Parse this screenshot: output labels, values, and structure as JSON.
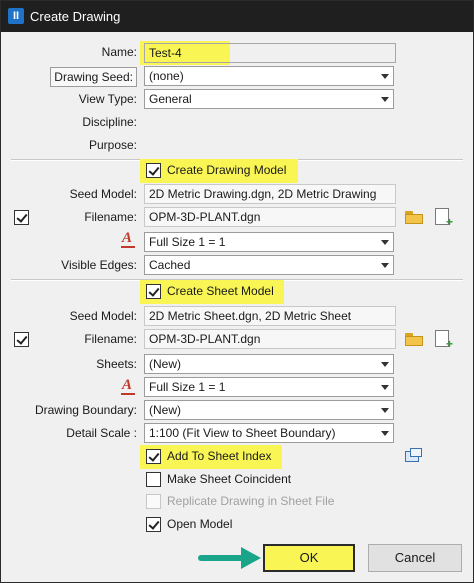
{
  "window": {
    "title": "Create Drawing",
    "app_icon_text": "II"
  },
  "general": {
    "name_label": "Name:",
    "name_value": "Test-4",
    "seed_label": "Drawing Seed:",
    "seed_value": "(none)",
    "view_type_label": "View Type:",
    "view_type_value": "General",
    "discipline_label": "Discipline:",
    "purpose_label": "Purpose:"
  },
  "drawing_model": {
    "create_label": "Create Drawing Model",
    "create_checked": true,
    "seed_model_label": "Seed Model:",
    "seed_model_value": "2D Metric Drawing.dgn, 2D Metric Drawing",
    "filename_label": "Filename:",
    "filename_value": "OPM-3D-PLANT.dgn",
    "filename_checked": true,
    "annotation_scale_value": "Full Size 1 = 1",
    "visible_edges_label": "Visible Edges:",
    "visible_edges_value": "Cached"
  },
  "sheet_model": {
    "create_label": "Create Sheet Model",
    "create_checked": true,
    "seed_model_label": "Seed Model:",
    "seed_model_value": "2D Metric Sheet.dgn, 2D Metric Sheet",
    "filename_label": "Filename:",
    "filename_value": "OPM-3D-PLANT.dgn",
    "filename_checked": true,
    "sheets_label": "Sheets:",
    "sheets_value": "(New)",
    "annotation_scale_value": "Full Size 1 = 1",
    "boundary_label": "Drawing Boundary:",
    "boundary_value": "(New)",
    "detail_scale_label": "Detail Scale :",
    "detail_scale_value": "1:100 (Fit View to Sheet Boundary)",
    "add_index_label": "Add To Sheet Index",
    "add_index_checked": true,
    "coincident_label": "Make Sheet Coincident",
    "coincident_checked": false,
    "replicate_label": "Replicate Drawing in Sheet File",
    "replicate_checked": false,
    "open_model_label": "Open Model",
    "open_model_checked": true
  },
  "buttons": {
    "ok": "OK",
    "cancel": "Cancel"
  },
  "colors": {
    "highlight": "#f8f554",
    "annotation_arrow": "#1aa58a",
    "titlebar": "#1f1f1f"
  }
}
